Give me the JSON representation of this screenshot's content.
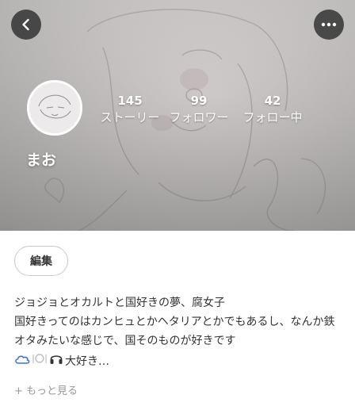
{
  "header": {
    "back_icon": "chevron-left-icon",
    "more_icon": "more-horizontal-icon"
  },
  "profile": {
    "name": "まお",
    "stats": [
      {
        "value": "145",
        "label": "ストーリー"
      },
      {
        "value": "99",
        "label": "フォロワー"
      },
      {
        "value": "42",
        "label": "フォロー中"
      }
    ]
  },
  "actions": {
    "edit_label": "編集"
  },
  "bio": {
    "line1": "ジョジョとオカルトと国好きの夢、腐女子",
    "line2": "国好きってのはカンヒュとかヘタリアとかでもあるし、なんか鉄オタみたいな感じで、国そのものが好きです",
    "line3_text": "大好き…",
    "line3_icons": [
      "cloud-icon",
      "plate-cutlery-icon",
      "headphones-icon"
    ]
  },
  "more_link": "+ もっと見る",
  "colors": {
    "overlay_button": "#2a2a2a",
    "text_primary": "#333333",
    "text_muted": "#999999"
  }
}
